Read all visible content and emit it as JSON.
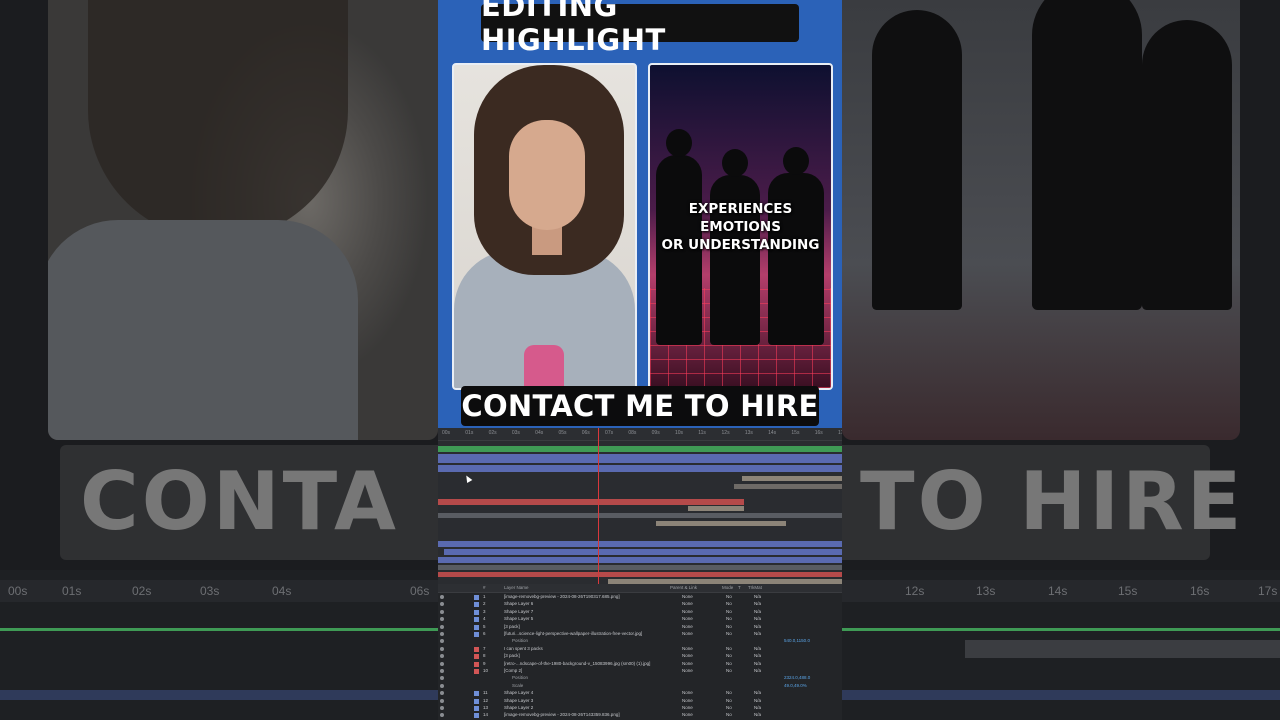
{
  "title": "EDITING HIGHLIGHT",
  "right_frame_text": [
    "EXPERIENCES",
    "EMOTIONS",
    "OR UNDERSTANDING"
  ],
  "cta": "CONTACT ME TO HIRE",
  "background": {
    "caption_left": "CONTA",
    "caption_right": "TO HIRE",
    "ruler_ticks": [
      "00s",
      "01s",
      "02s",
      "03s",
      "04s",
      "06s",
      "12s",
      "13s",
      "14s",
      "15s",
      "16s",
      "17s"
    ]
  },
  "timeline": {
    "ruler_ticks": [
      "00s",
      "01s",
      "02s",
      "03s",
      "04s",
      "05s",
      "06s",
      "07s",
      "08s",
      "09s",
      "10s",
      "11s",
      "12s",
      "13s",
      "14s",
      "15s",
      "16s",
      "17s"
    ]
  },
  "layer_panel": {
    "columns": [
      "#",
      "Layer Name",
      "Parent & Link",
      "Mode",
      "T",
      "TrkMat"
    ],
    "rows": [
      {
        "num": "1",
        "name": "[image-removebg-preview - 2024-08-26T190317.685.png]",
        "mode": "None",
        "parent": "N/a",
        "trk": "No",
        "color": "#6f8fd8"
      },
      {
        "num": "2",
        "name": "Shape Layer 6",
        "mode": "None",
        "parent": "N/a",
        "trk": "No",
        "color": "#6f8fd8"
      },
      {
        "num": "3",
        "name": "Shape Layer 7",
        "mode": "None",
        "parent": "N/a",
        "trk": "No",
        "color": "#6f8fd8"
      },
      {
        "num": "4",
        "name": "Shape Layer 5",
        "mode": "None",
        "parent": "N/a",
        "trk": "No",
        "color": "#6f8fd8"
      },
      {
        "num": "5",
        "name": "[3 pack]",
        "mode": "None",
        "parent": "N/a",
        "trk": "No",
        "color": "#6f8fd8"
      },
      {
        "num": "6",
        "name": "[futuri...science-light-perspective-wallpaper-illustration-free-vector.jpg]",
        "mode": "None",
        "parent": "N/a",
        "trk": "No",
        "color": "#6f8fd8"
      },
      {
        "num": "",
        "name": "Position",
        "mode": "",
        "parent": "",
        "trk": "",
        "color": "",
        "value": "540.0,1150.0"
      },
      {
        "num": "7",
        "name": "I can spent 3 packs",
        "mode": "None",
        "parent": "N/a",
        "trk": "No",
        "color": "#d25656"
      },
      {
        "num": "8",
        "name": "[3 pack]",
        "mode": "None",
        "parent": "N/a",
        "trk": "No",
        "color": "#d25656"
      },
      {
        "num": "9",
        "name": "[retro-...ndscape-of-the-1980-background-v_15083996.jpg (sm00) (1).jpg]",
        "mode": "None",
        "parent": "N/a",
        "trk": "No",
        "color": "#d25656"
      },
      {
        "num": "10",
        "name": "[Comp 2]",
        "mode": "None",
        "parent": "N/a",
        "trk": "No",
        "color": "#d25656"
      },
      {
        "num": "",
        "name": "Position",
        "mode": "",
        "parent": "",
        "trk": "",
        "color": "",
        "value": "2324.0,488.0"
      },
      {
        "num": "",
        "name": "Scale",
        "mode": "",
        "parent": "",
        "trk": "",
        "color": "",
        "value": "49.0,49.0%"
      },
      {
        "num": "11",
        "name": "Shape Layer 4",
        "mode": "None",
        "parent": "N/a",
        "trk": "No",
        "color": "#6f8fd8"
      },
      {
        "num": "12",
        "name": "Shape Layer 3",
        "mode": "None",
        "parent": "N/a",
        "trk": "No",
        "color": "#6f8fd8"
      },
      {
        "num": "13",
        "name": "Shape Layer 2",
        "mode": "None",
        "parent": "N/a",
        "trk": "No",
        "color": "#6f8fd8"
      },
      {
        "num": "14",
        "name": "[image-removebg-preview - 2024-08-26T143359.836.png]",
        "mode": "None",
        "parent": "N/a",
        "trk": "No",
        "color": "#6f8fd8"
      }
    ]
  },
  "colors": {
    "accent": "#2b62b8",
    "playhead": "#d9383c",
    "blue_bar": "#5a6ab0",
    "red_bar": "#b54a4a",
    "green_bar": "#3f9a55",
    "gray_bar": "#8c8478"
  }
}
